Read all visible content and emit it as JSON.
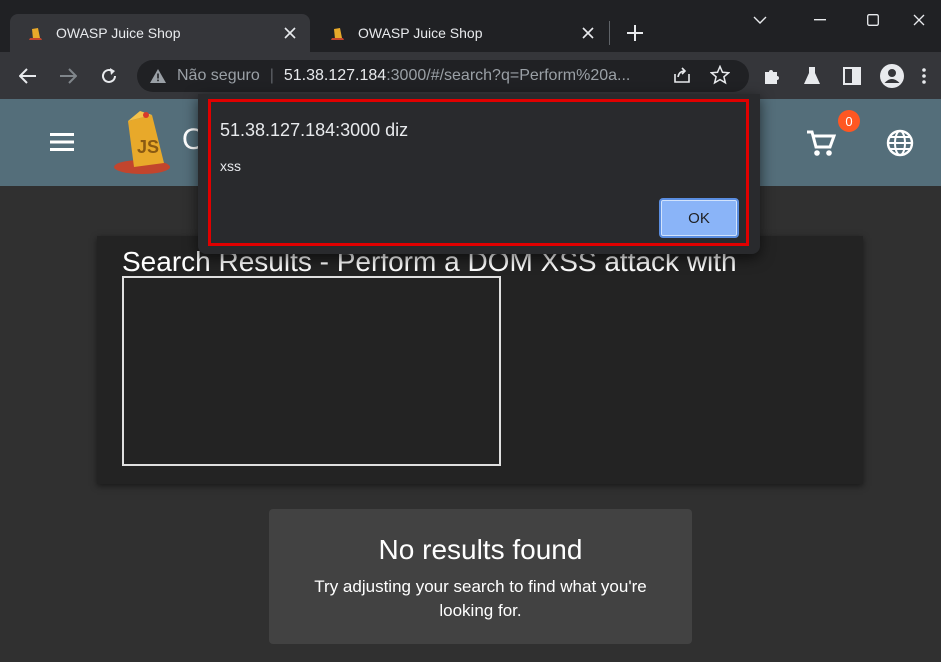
{
  "browser": {
    "tabs": [
      {
        "title": "OWASP Juice Shop"
      },
      {
        "title": "OWASP Juice Shop"
      }
    ],
    "omnibox": {
      "security_label": "Não seguro",
      "separator": "|",
      "host": "51.38.127.184",
      "path": ":3000/#/search?q=Perform%20a..."
    }
  },
  "app": {
    "brand_partial": "O",
    "cart_count": "0"
  },
  "search": {
    "heading": "Search Results - Perform a DOM XSS attack with"
  },
  "no_results": {
    "title": "No results found",
    "message": "Try adjusting your search to find what you're looking for."
  },
  "alert": {
    "title": "51.38.127.184:3000 diz",
    "message": "xss",
    "ok_label": "OK"
  },
  "colors": {
    "appbar": "#546e7a",
    "badge": "#ff5722",
    "highlight": "#e00000",
    "ok_button": "#8ab4f8"
  }
}
